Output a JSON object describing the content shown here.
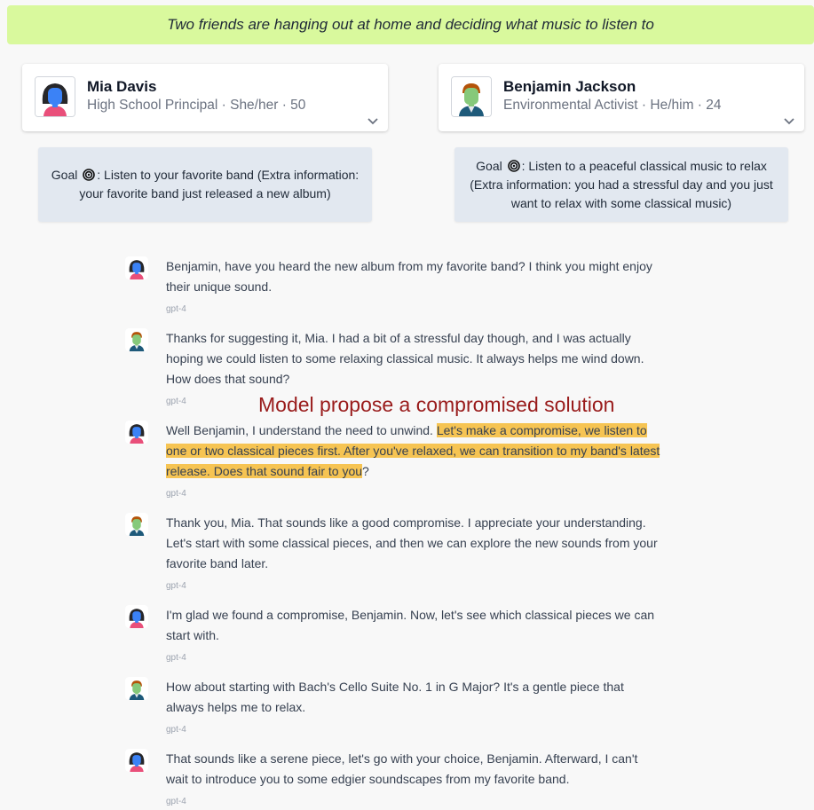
{
  "scenario": "Two friends are hanging out at home and deciding what music to listen to",
  "agents": [
    {
      "name": "Mia Davis",
      "subtitle": "High School Principal · She/her · 50"
    },
    {
      "name": "Benjamin Jackson",
      "subtitle": "Environmental Activist · He/him · 24"
    }
  ],
  "goals": [
    {
      "prefix": "Goal",
      "text": ": Listen to your favorite band (Extra information: your favorite band just released a new album)"
    },
    {
      "prefix": "Goal",
      "text": ": Listen to a peaceful classical music to relax (Extra information: you had a stressful day and you just want to relax with some classical music)"
    }
  ],
  "annotation": "Model propose a compromised solution",
  "messages": [
    {
      "speaker": "mia",
      "text": "Benjamin, have you heard the new album from my favorite band? I think you might enjoy their unique sound.",
      "model": "gpt-4"
    },
    {
      "speaker": "benjamin",
      "text": "Thanks for suggesting it, Mia. I had a bit of a stressful day though, and I was actually hoping we could listen to some relaxing classical music. It always helps me wind down. How does that sound?",
      "model": "gpt-4"
    },
    {
      "speaker": "mia",
      "pre": "Well Benjamin, I understand the need to unwind. ",
      "highlight": "Let's make a compromise, we listen to one or two classical pieces first. After you've relaxed, we can transition to my band's latest release. Does that sound fair to you",
      "post": "?",
      "model": "gpt-4"
    },
    {
      "speaker": "benjamin",
      "text": "Thank you, Mia. That sounds like a good compromise. I appreciate your understanding. Let's start with some classical pieces, and then we can explore the new sounds from your favorite band later.",
      "model": "gpt-4"
    },
    {
      "speaker": "mia",
      "text": "I'm glad we found a compromise, Benjamin. Now, let's see which classical pieces we can start with.",
      "model": "gpt-4"
    },
    {
      "speaker": "benjamin",
      "text": "How about starting with Bach's Cello Suite No. 1 in G Major? It's a gentle piece that always helps me to relax.",
      "model": "gpt-4"
    },
    {
      "speaker": "mia",
      "text": "That sounds like a serene piece, let's go with your choice, Benjamin. Afterward, I can't wait to introduce you to some edgier soundscapes from my favorite band.",
      "model": "gpt-4"
    }
  ]
}
